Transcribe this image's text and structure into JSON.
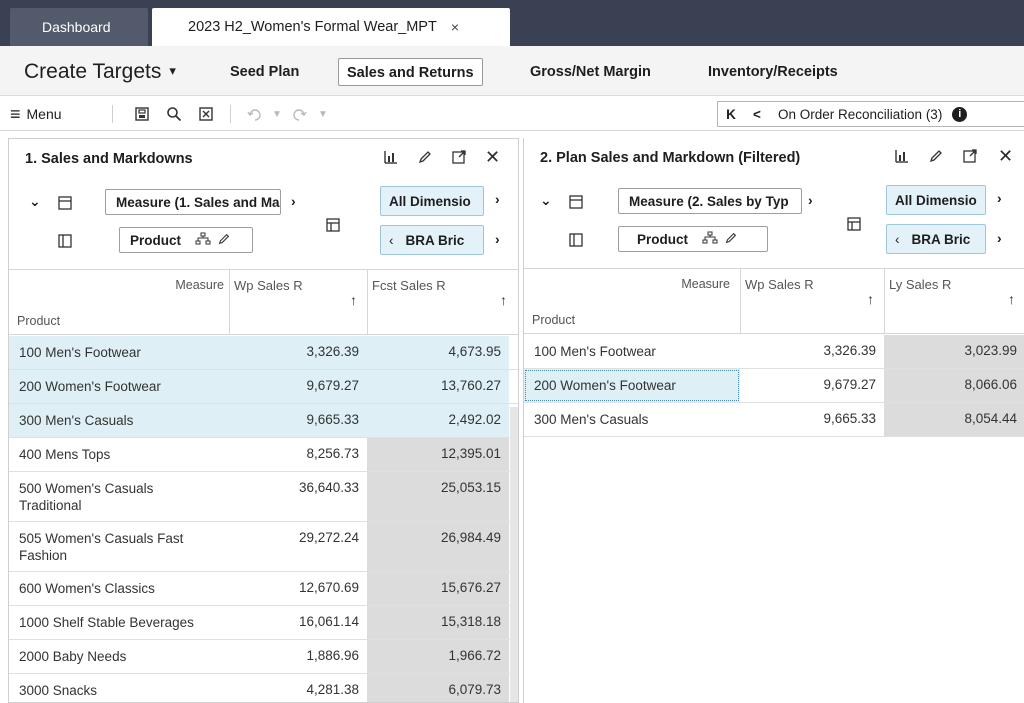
{
  "tabs": {
    "dashboard": "Dashboard",
    "active": "2023 H2_Women's Formal Wear_MPT",
    "close": "×"
  },
  "header": {
    "title": "Create Targets",
    "caret": "▾",
    "links": [
      "Seed Plan",
      "Sales and Returns",
      "Gross/Net Margin",
      "Inventory/Receipts"
    ],
    "selected_link": "Sales and Returns"
  },
  "toolbar": {
    "menu_label": "Menu",
    "menu_icon": "≡",
    "nav_first": "K",
    "nav_prev": "<",
    "reconciliation_label": "On Order Reconciliation (3)",
    "info_icon": "i"
  },
  "left_pane": {
    "title": "1. Sales and Markdowns",
    "measure_field": "Measure (1. Sales and Ma",
    "product_field": "Product",
    "all_dimensions": "All Dimensio",
    "bra_field": "BRA Bric",
    "col_measure": "Measure",
    "col_product": "Product",
    "columns": [
      "Wp Sales R",
      "Fcst Sales R"
    ],
    "rows": [
      {
        "label": "100 Men's Footwear",
        "wp": "3,326.39",
        "fcst": "4,673.95"
      },
      {
        "label": "200 Women's Footwear",
        "wp": "9,679.27",
        "fcst": "13,760.27"
      },
      {
        "label": "300 Men's Casuals",
        "wp": "9,665.33",
        "fcst": "2,492.02"
      },
      {
        "label": "400 Mens Tops",
        "wp": "8,256.73",
        "fcst": "12,395.01"
      },
      {
        "label": "500 Women's Casuals Traditional",
        "wp": "36,640.33",
        "fcst": "25,053.15"
      },
      {
        "label": "505 Women's Casuals Fast Fashion",
        "wp": "29,272.24",
        "fcst": "26,984.49"
      },
      {
        "label": "600 Women's Classics",
        "wp": "12,670.69",
        "fcst": "15,676.27"
      },
      {
        "label": "1000 Shelf Stable Beverages",
        "wp": "16,061.14",
        "fcst": "15,318.18"
      },
      {
        "label": "2000 Baby Needs",
        "wp": "1,886.96",
        "fcst": "1,966.72"
      },
      {
        "label": "3000 Snacks",
        "wp": "4,281.38",
        "fcst": "6,079.73"
      }
    ]
  },
  "right_pane": {
    "title": "2. Plan Sales and Markdown (Filtered)",
    "measure_field": "Measure (2. Sales by Typ",
    "product_field": "Product",
    "all_dimensions": "All Dimensio",
    "bra_field": "BRA Bric",
    "col_measure": "Measure",
    "col_product": "Product",
    "columns": [
      "Wp Sales R",
      "Ly Sales R"
    ],
    "rows": [
      {
        "label": "100 Men's Footwear",
        "wp": "3,326.39",
        "ly": "3,023.99"
      },
      {
        "label": "200 Women's Footwear",
        "wp": "9,679.27",
        "ly": "8,066.06"
      },
      {
        "label": "300 Men's Casuals",
        "wp": "9,665.33",
        "ly": "8,054.44"
      }
    ]
  }
}
